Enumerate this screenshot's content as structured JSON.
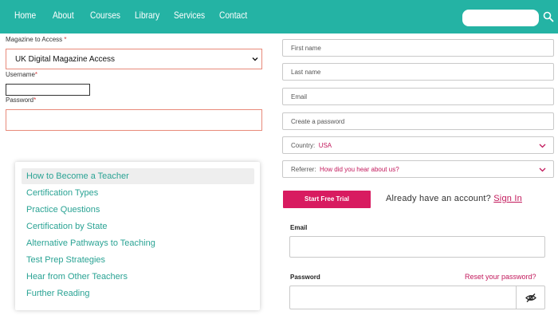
{
  "nav": {
    "items": [
      "Home",
      "About",
      "Courses",
      "Library",
      "Services",
      "Contact"
    ],
    "search_icon": "search-icon"
  },
  "login_form": {
    "magazine_label": "Magazine to Access",
    "magazine_value": "UK Digital Magazine Access",
    "username_label": "Username",
    "password_label": "Password",
    "required_mark": "*"
  },
  "menu": {
    "items": [
      "How to Become a Teacher",
      "Certification Types",
      "Practice Questions",
      "Certification by State",
      "Alternative Pathways to Teaching",
      "Test Prep Strategies",
      "Hear from Other Teachers",
      "Further Reading"
    ],
    "active_index": 0
  },
  "signup": {
    "first_name_placeholder": "First name",
    "last_name_placeholder": "Last name",
    "email_placeholder": "Email",
    "password_placeholder": "Create a password",
    "country_label": "Country:",
    "country_value": "USA",
    "referrer_label": "Referrer:",
    "referrer_value": "How did you hear about us?",
    "trial_button": "Start Free Trial",
    "already_text": "Already have an account?",
    "sign_in": "Sign In"
  },
  "signin_form": {
    "email_label": "Email",
    "password_label": "Password",
    "reset_link": "Reset your password?",
    "eye_icon": "eye-slash-icon"
  },
  "colors": {
    "nav_bg": "#24b3a4",
    "accent": "#d81b60",
    "menu_text": "#2aa394",
    "error_border": "#e88a7a"
  }
}
